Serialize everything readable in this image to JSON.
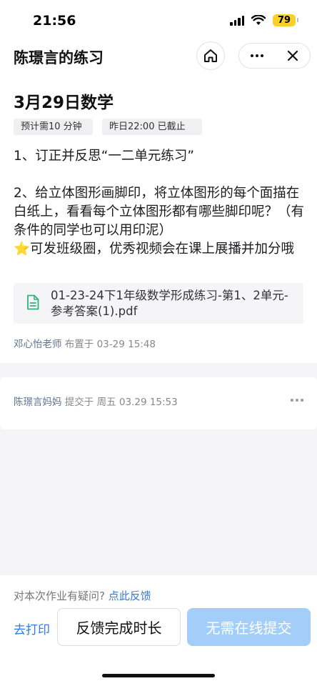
{
  "status_bar": {
    "time": "21:56",
    "battery": "79"
  },
  "nav": {
    "title": "陈璟言的练习"
  },
  "homework": {
    "title": "3月29日数学",
    "tags": [
      "预计需10 分钟",
      "昨日22:00 已截止"
    ],
    "item1": "1、订正并反思“一二单元练习”",
    "item2": "2、给立体图形画脚印，将立体图形的每个面描在白纸上，看看每个立体图形都有哪些脚印呢？（有条件的同学也可以用印泥）",
    "star": "⭐",
    "item3": "可发班级圈，优秀视频会在课上展播并加分哦",
    "attachment_name": "01-23-24下1年级数学形成练习-第1、2单元-参考答案(1).pdf",
    "teacher": "邓心怡老师",
    "published_label": "布置于",
    "published_time": "03-29 15:48"
  },
  "submission": {
    "submitter": "陈璟言妈妈",
    "submitted_label": "提交于",
    "submitted_time": "周五 03.29 15:53"
  },
  "bottom": {
    "question_text": "对本次作业有疑问?",
    "question_link": "点此反馈",
    "print_label": "去打印",
    "feedback_label": "反馈完成时长",
    "submit_label": "无需在线提交"
  },
  "colors": {
    "accent": "#2f7be8",
    "submit_disabled": "#a3cef9",
    "pdf_icon": "#2fb37a",
    "star": "#f3b81f"
  }
}
